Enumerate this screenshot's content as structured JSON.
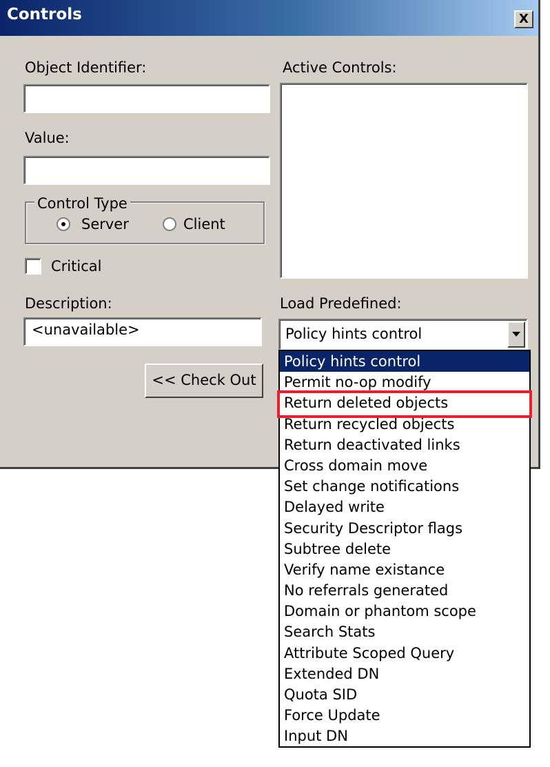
{
  "window": {
    "title": "Controls",
    "close_label": "X"
  },
  "form": {
    "object_identifier_label": "Object Identifier:",
    "object_identifier_value": "",
    "value_label": "Value:",
    "value_value": "",
    "control_type_label": "Control Type",
    "radio_server_label": "Server",
    "radio_client_label": "Client",
    "selected_control_type": "Server",
    "critical_label": "Critical",
    "critical_checked": false,
    "description_label": "Description:",
    "description_value": "<unavailable>",
    "check_out_label": "<< Check Out",
    "active_controls_label": "Active Controls:",
    "active_controls_items": [],
    "load_predefined_label": "Load Predefined:",
    "load_predefined_selected": "Policy hints control"
  },
  "dropdown": {
    "items": [
      "Policy hints control",
      "Permit no-op modify",
      "Return deleted objects",
      "Return recycled objects",
      "Return deactivated links",
      "Cross domain move",
      "Set change notifications",
      "Delayed write",
      "Security Descriptor flags",
      "Subtree delete",
      "Verify name existance",
      "No referrals generated",
      "Domain or phantom scope",
      "Search Stats",
      "Attribute Scoped Query",
      "Extended DN",
      "Quota SID",
      "Force Update",
      "Input DN"
    ],
    "selected_index": 0,
    "annotated_index": 2
  },
  "colors": {
    "dialog_bg": "#d4d0c8",
    "title_start": "#0a246a",
    "selection": "#0a246a",
    "annotation": "#e8212c"
  }
}
